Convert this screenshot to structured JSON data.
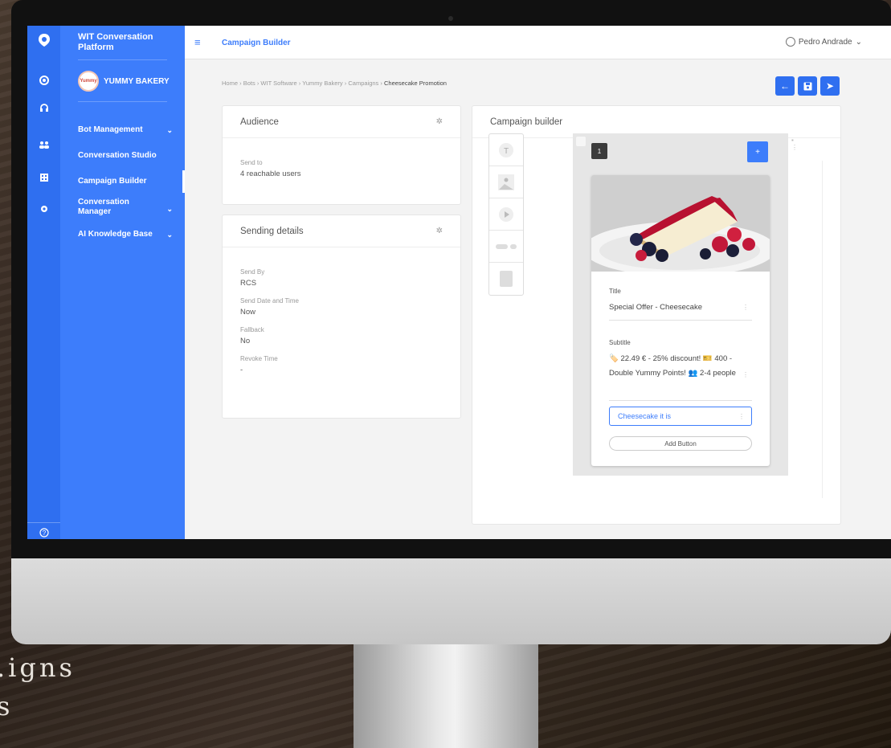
{
  "background_text": {
    "line1": ".igns",
    "line2": "s"
  },
  "sidebar": {
    "platform_title": "WIT Conversation Platform",
    "bot_name": "YUMMY BAKERY",
    "bot_logo_text": "Yummy",
    "items": [
      {
        "label": "Bot Management",
        "has_chevron": true
      },
      {
        "label": "Conversation Studio",
        "has_chevron": false
      },
      {
        "label": "Campaign Builder",
        "has_chevron": false,
        "active": true
      },
      {
        "label": "Conversation Manager",
        "has_chevron": true
      },
      {
        "label": "AI Knowledge Base",
        "has_chevron": true
      }
    ],
    "rail_icons": [
      "logo-icon",
      "bot-icon",
      "headset-icon",
      "users-icon",
      "building-icon",
      "gear-icon",
      "help-icon"
    ]
  },
  "topbar": {
    "title": "Campaign Builder",
    "user_name": "Pedro Andrade",
    "user_chevron": "⌄"
  },
  "breadcrumb": {
    "items": [
      "Home",
      "Bots",
      "WIT Software",
      "Yummy Bakery",
      "Campaigns"
    ],
    "current": "Cheesecake Promotion",
    "separator": "›"
  },
  "actions": {
    "back": "←",
    "save": "💾",
    "send": "➤"
  },
  "audience": {
    "title": "Audience",
    "send_to_label": "Send to",
    "send_to_value": "4 reachable users"
  },
  "sending": {
    "title": "Sending details",
    "fields": [
      {
        "label": "Send By",
        "value": "RCS"
      },
      {
        "label": "Send Date and Time",
        "value": "Now"
      },
      {
        "label": "Fallback",
        "value": "No"
      },
      {
        "label": "Revoke Time",
        "value": "-"
      }
    ]
  },
  "builder": {
    "title": "Campaign builder",
    "card_number": "1",
    "add_symbol": "+",
    "title_label": "Title",
    "title_value": "Special Offer - Cheesecake",
    "subtitle_label": "Subtitle",
    "subtitle_value": "🏷️ 22.49 € - 25% discount! 🎫 400 - Double Yummy Points! 👥 2-4 people",
    "button_label": "Cheesecake it is",
    "add_button": "Add Button",
    "palette_icons": [
      "text-icon",
      "image-icon",
      "video-icon",
      "suggestion-icon",
      "carousel-icon"
    ]
  },
  "colors": {
    "accent": "#3d7dfb",
    "sidebar": "#3d7dfb",
    "rail": "#2f6ff0"
  }
}
